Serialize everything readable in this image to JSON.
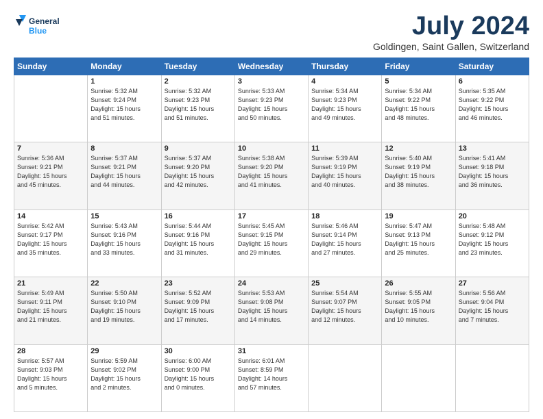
{
  "header": {
    "logo_line1": "General",
    "logo_line2": "Blue",
    "month": "July 2024",
    "location": "Goldingen, Saint Gallen, Switzerland"
  },
  "days_of_week": [
    "Sunday",
    "Monday",
    "Tuesday",
    "Wednesday",
    "Thursday",
    "Friday",
    "Saturday"
  ],
  "weeks": [
    [
      {
        "day": "",
        "info": ""
      },
      {
        "day": "1",
        "info": "Sunrise: 5:32 AM\nSunset: 9:24 PM\nDaylight: 15 hours\nand 51 minutes."
      },
      {
        "day": "2",
        "info": "Sunrise: 5:32 AM\nSunset: 9:23 PM\nDaylight: 15 hours\nand 51 minutes."
      },
      {
        "day": "3",
        "info": "Sunrise: 5:33 AM\nSunset: 9:23 PM\nDaylight: 15 hours\nand 50 minutes."
      },
      {
        "day": "4",
        "info": "Sunrise: 5:34 AM\nSunset: 9:23 PM\nDaylight: 15 hours\nand 49 minutes."
      },
      {
        "day": "5",
        "info": "Sunrise: 5:34 AM\nSunset: 9:22 PM\nDaylight: 15 hours\nand 48 minutes."
      },
      {
        "day": "6",
        "info": "Sunrise: 5:35 AM\nSunset: 9:22 PM\nDaylight: 15 hours\nand 46 minutes."
      }
    ],
    [
      {
        "day": "7",
        "info": "Sunrise: 5:36 AM\nSunset: 9:21 PM\nDaylight: 15 hours\nand 45 minutes."
      },
      {
        "day": "8",
        "info": "Sunrise: 5:37 AM\nSunset: 9:21 PM\nDaylight: 15 hours\nand 44 minutes."
      },
      {
        "day": "9",
        "info": "Sunrise: 5:37 AM\nSunset: 9:20 PM\nDaylight: 15 hours\nand 42 minutes."
      },
      {
        "day": "10",
        "info": "Sunrise: 5:38 AM\nSunset: 9:20 PM\nDaylight: 15 hours\nand 41 minutes."
      },
      {
        "day": "11",
        "info": "Sunrise: 5:39 AM\nSunset: 9:19 PM\nDaylight: 15 hours\nand 40 minutes."
      },
      {
        "day": "12",
        "info": "Sunrise: 5:40 AM\nSunset: 9:19 PM\nDaylight: 15 hours\nand 38 minutes."
      },
      {
        "day": "13",
        "info": "Sunrise: 5:41 AM\nSunset: 9:18 PM\nDaylight: 15 hours\nand 36 minutes."
      }
    ],
    [
      {
        "day": "14",
        "info": "Sunrise: 5:42 AM\nSunset: 9:17 PM\nDaylight: 15 hours\nand 35 minutes."
      },
      {
        "day": "15",
        "info": "Sunrise: 5:43 AM\nSunset: 9:16 PM\nDaylight: 15 hours\nand 33 minutes."
      },
      {
        "day": "16",
        "info": "Sunrise: 5:44 AM\nSunset: 9:16 PM\nDaylight: 15 hours\nand 31 minutes."
      },
      {
        "day": "17",
        "info": "Sunrise: 5:45 AM\nSunset: 9:15 PM\nDaylight: 15 hours\nand 29 minutes."
      },
      {
        "day": "18",
        "info": "Sunrise: 5:46 AM\nSunset: 9:14 PM\nDaylight: 15 hours\nand 27 minutes."
      },
      {
        "day": "19",
        "info": "Sunrise: 5:47 AM\nSunset: 9:13 PM\nDaylight: 15 hours\nand 25 minutes."
      },
      {
        "day": "20",
        "info": "Sunrise: 5:48 AM\nSunset: 9:12 PM\nDaylight: 15 hours\nand 23 minutes."
      }
    ],
    [
      {
        "day": "21",
        "info": "Sunrise: 5:49 AM\nSunset: 9:11 PM\nDaylight: 15 hours\nand 21 minutes."
      },
      {
        "day": "22",
        "info": "Sunrise: 5:50 AM\nSunset: 9:10 PM\nDaylight: 15 hours\nand 19 minutes."
      },
      {
        "day": "23",
        "info": "Sunrise: 5:52 AM\nSunset: 9:09 PM\nDaylight: 15 hours\nand 17 minutes."
      },
      {
        "day": "24",
        "info": "Sunrise: 5:53 AM\nSunset: 9:08 PM\nDaylight: 15 hours\nand 14 minutes."
      },
      {
        "day": "25",
        "info": "Sunrise: 5:54 AM\nSunset: 9:07 PM\nDaylight: 15 hours\nand 12 minutes."
      },
      {
        "day": "26",
        "info": "Sunrise: 5:55 AM\nSunset: 9:05 PM\nDaylight: 15 hours\nand 10 minutes."
      },
      {
        "day": "27",
        "info": "Sunrise: 5:56 AM\nSunset: 9:04 PM\nDaylight: 15 hours\nand 7 minutes."
      }
    ],
    [
      {
        "day": "28",
        "info": "Sunrise: 5:57 AM\nSunset: 9:03 PM\nDaylight: 15 hours\nand 5 minutes."
      },
      {
        "day": "29",
        "info": "Sunrise: 5:59 AM\nSunset: 9:02 PM\nDaylight: 15 hours\nand 2 minutes."
      },
      {
        "day": "30",
        "info": "Sunrise: 6:00 AM\nSunset: 9:00 PM\nDaylight: 15 hours\nand 0 minutes."
      },
      {
        "day": "31",
        "info": "Sunrise: 6:01 AM\nSunset: 8:59 PM\nDaylight: 14 hours\nand 57 minutes."
      },
      {
        "day": "",
        "info": ""
      },
      {
        "day": "",
        "info": ""
      },
      {
        "day": "",
        "info": ""
      }
    ]
  ]
}
